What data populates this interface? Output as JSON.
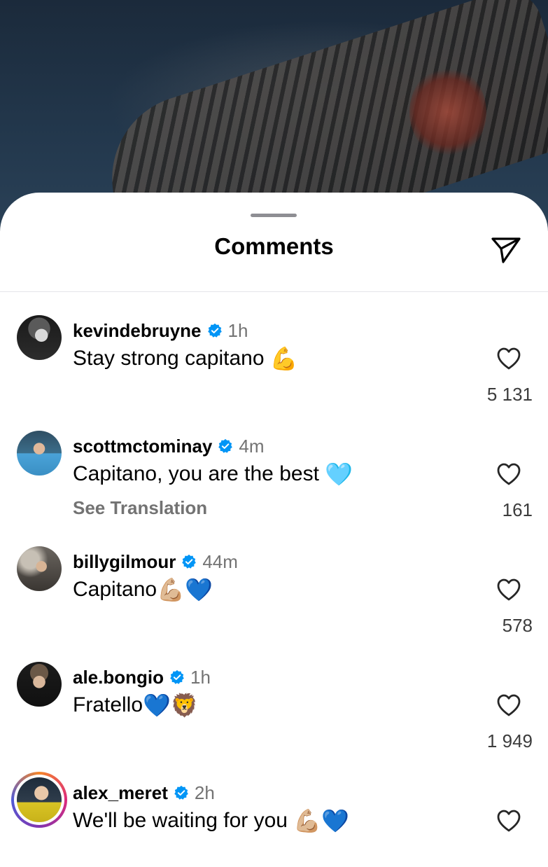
{
  "header": {
    "title": "Comments"
  },
  "comments": [
    {
      "username": "kevindebruyne",
      "verified": true,
      "time": "1h",
      "text": "Stay strong capitano",
      "emoji": "💪",
      "see_translation": "",
      "likes": "5 131",
      "avatar_icon": "profile-photo"
    },
    {
      "username": "scottmctominay",
      "verified": true,
      "time": "4m",
      "text": "Capitano, you are the best",
      "emoji": "🩵",
      "see_translation": "See Translation",
      "likes": "161",
      "avatar_icon": "profile-photo"
    },
    {
      "username": "billygilmour",
      "verified": true,
      "time": "44m",
      "text": "Capitano",
      "emoji": "💪🏼💙",
      "see_translation": "",
      "likes": "578",
      "avatar_icon": "profile-photo"
    },
    {
      "username": "ale.bongio",
      "verified": true,
      "time": "1h",
      "text": "Fratello",
      "emoji": "💙🦁",
      "see_translation": "",
      "likes": "1 949",
      "avatar_icon": "profile-photo"
    },
    {
      "username": "alex_meret",
      "verified": true,
      "time": "2h",
      "text": "We'll be waiting for you",
      "emoji": "💪🏼💙",
      "see_translation": "",
      "likes": "",
      "avatar_icon": "profile-photo-with-story-ring"
    }
  ],
  "colors": {
    "verified_blue": "#0095f6",
    "secondary_text": "#737373"
  }
}
